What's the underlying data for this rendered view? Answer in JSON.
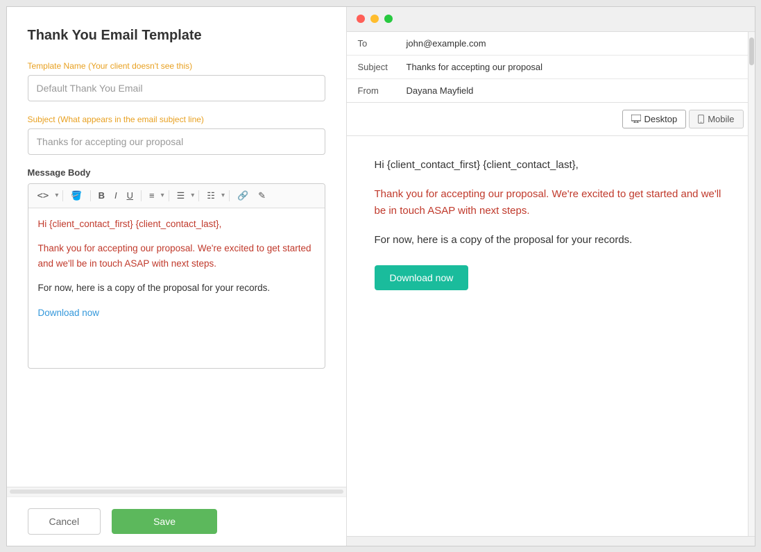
{
  "page": {
    "title": "Thank You Email Template"
  },
  "left_panel": {
    "title": "Thank You Email Template",
    "template_name_label": "Template Name",
    "template_name_hint": "(Your client doesn't see this)",
    "template_name_value": "Default Thank You Email",
    "subject_label": "Subject",
    "subject_hint": "(What appears in the email subject line)",
    "subject_value": "Thanks for accepting our proposal",
    "message_body_label": "Message Body",
    "editor": {
      "hi_line": "Hi {client_contact_first} {client_contact_last},",
      "thank_para": "Thank you for accepting our proposal. We're excited to get started and we'll be in touch ASAP with next steps.",
      "for_now": "For now, here is a copy of the proposal for your records.",
      "download_link": "Download now"
    },
    "cancel_label": "Cancel",
    "save_label": "Save"
  },
  "right_panel": {
    "email_to_label": "To",
    "email_to_value": "john@example.com",
    "email_subject_label": "Subject",
    "email_subject_value": "Thanks for accepting our proposal",
    "email_from_label": "From",
    "email_from_value": "Dayana Mayfield",
    "desktop_label": "Desktop",
    "mobile_label": "Mobile",
    "preview": {
      "hi_line": "Hi {client_contact_first} {client_contact_last},",
      "thank_para": "Thank you for accepting our proposal. We're excited to get started and we'll be in touch ASAP with next steps.",
      "for_now": "For now, here is a copy of the proposal for your records.",
      "download_btn": "Download now"
    }
  },
  "toolbar": {
    "code": "<>",
    "paint": "🎨",
    "bold": "B",
    "italic": "I",
    "underline": "U",
    "align": "≡",
    "list_ordered": "≡",
    "list_unordered": "≡",
    "link": "🔗",
    "clear": "✎"
  }
}
